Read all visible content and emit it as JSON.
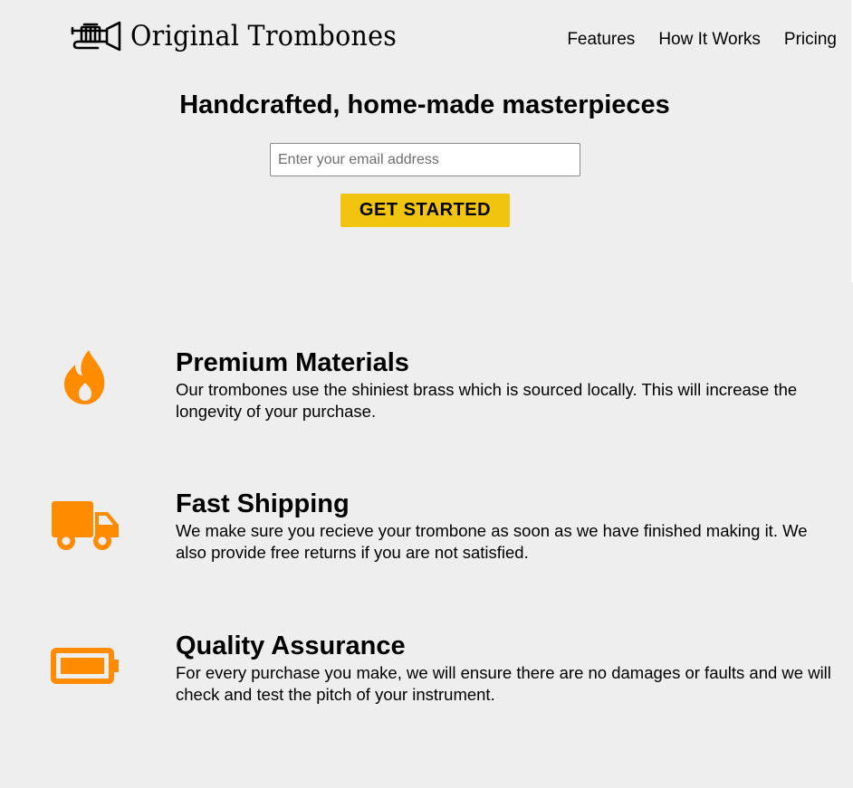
{
  "header": {
    "brand_name": "Original Trombones",
    "logo_icon": "trombone-icon",
    "nav": [
      {
        "label": "Features"
      },
      {
        "label": "How It Works"
      },
      {
        "label": "Pricing"
      }
    ]
  },
  "hero": {
    "title": "Handcrafted, home-made masterpieces",
    "email_placeholder": "Enter your email address",
    "email_value": "",
    "cta_label": "GET STARTED"
  },
  "features": [
    {
      "icon": "fire-icon",
      "title": "Premium Materials",
      "description": "Our trombones use the shiniest brass which is sourced locally. This will increase the longevity of your purchase."
    },
    {
      "icon": "truck-icon",
      "title": "Fast Shipping",
      "description": "We make sure you recieve your trombone as soon as we have finished making it. We also provide free returns if you are not satisfied."
    },
    {
      "icon": "battery-icon",
      "title": "Quality Assurance",
      "description": "For every purchase you make, we will ensure there are no damages or faults and we will check and test the pitch of your instrument."
    }
  ],
  "colors": {
    "background": "#eeeeee",
    "accent_orange": "#ff8c00",
    "cta_yellow": "#f1c40f",
    "text": "#000000"
  }
}
